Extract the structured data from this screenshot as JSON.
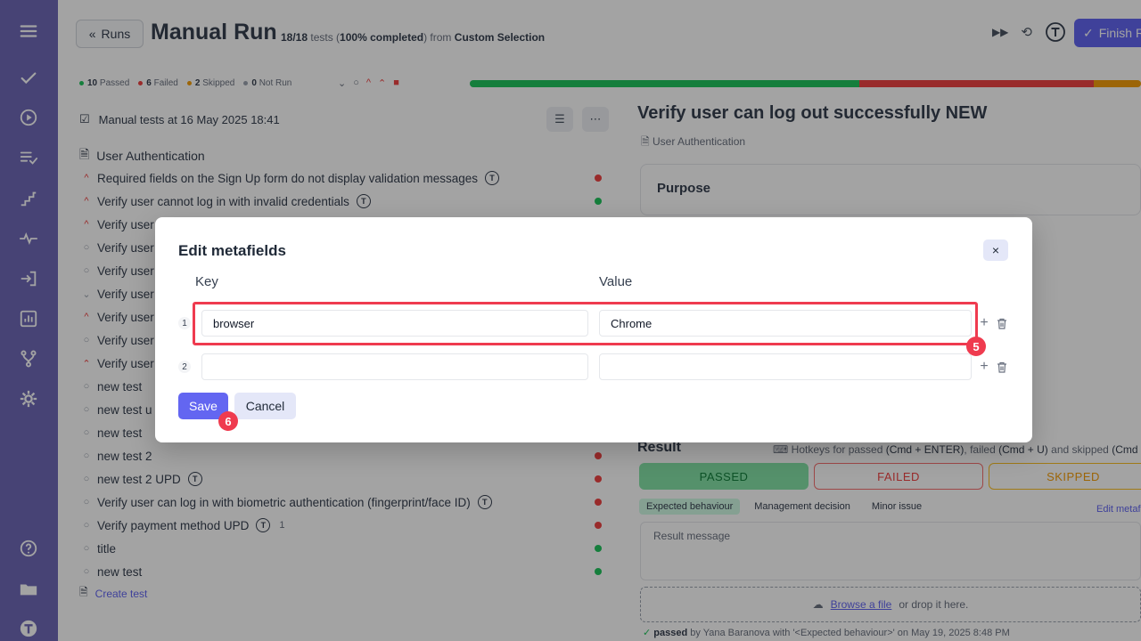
{
  "header": {
    "runs_label": "Runs",
    "title": "Manual Run",
    "count": "18/18",
    "tests_word": "tests (",
    "percent": "100% completed",
    "from_text": ") from",
    "selection": "Custom Selection",
    "finish_label": "Finish R"
  },
  "stats": {
    "passed": "10",
    "passed_label": "Passed",
    "failed": "6",
    "failed_label": "Failed",
    "skipped": "2",
    "skipped_label": "Skipped",
    "notrun": "0",
    "notrun_label": "Not Run"
  },
  "progress": {
    "passed_fraction": 0.58,
    "failed_fraction": 0.35,
    "skipped_fraction": 0.07
  },
  "tree": {
    "header": "Manual tests at 16 May 2025 18:41",
    "suite": "User Authentication",
    "tests": [
      {
        "title": "Required fields on the Sign Up form do not display validation messages",
        "priority": "^",
        "status": "failed"
      },
      {
        "title": "Verify user cannot log in with invalid credentials",
        "priority": "^",
        "status": "passed"
      },
      {
        "title": "Verify user",
        "priority": "^",
        "status": ""
      },
      {
        "title": "Verify user",
        "priority": "○",
        "status": ""
      },
      {
        "title": "Verify user",
        "priority": "○",
        "status": ""
      },
      {
        "title": "Verify user",
        "priority": "⌄",
        "status": ""
      },
      {
        "title": "Verify user",
        "priority": "^",
        "status": ""
      },
      {
        "title": "Verify user",
        "priority": "○",
        "status": ""
      },
      {
        "title": "Verify user",
        "priority": "⌃",
        "status": ""
      },
      {
        "title": "new test",
        "priority": "○",
        "status": ""
      },
      {
        "title": "new test u",
        "priority": "○",
        "status": ""
      },
      {
        "title": "new test",
        "priority": "○",
        "status": ""
      },
      {
        "title": "new test 2",
        "priority": "○",
        "status": "failed"
      },
      {
        "title": "new test 2 UPD",
        "priority": "○",
        "status": "failed"
      },
      {
        "title": "Verify user can log in with biometric authentication (fingerprint/face ID)",
        "priority": "○",
        "status": "failed"
      },
      {
        "title": "Verify payment method UPD",
        "priority": "○",
        "status": "failed",
        "extra": "1"
      },
      {
        "title": "title",
        "priority": "○",
        "status": "passed"
      },
      {
        "title": "new test",
        "priority": "○",
        "status": "passed"
      }
    ],
    "create_label": "Create test"
  },
  "detail": {
    "title": "Verify user can log out successfully NEW",
    "suite": "User Authentication",
    "purpose_label": "Purpose",
    "result_label": "Result",
    "hotkeys": {
      "prefix": "Hotkeys for passed",
      "passed_key": "(Cmd + ENTER)",
      "mid1": ", failed",
      "failed_key": "(Cmd + U)",
      "mid2": "and skipped",
      "skipped_key": "(Cmd -"
    },
    "passed_btn": "PASSED",
    "failed_btn": "FAILED",
    "skipped_btn": "SKIPPED",
    "chips": [
      "Expected behaviour",
      "Management decision",
      "Minor issue"
    ],
    "edit_metafields_link": "Edit metafi",
    "result_placeholder": "Result message",
    "browse": "Browse a file",
    "drop": "or drop it here.",
    "passed_by_prefix": "passed",
    "passed_by_by": "by Yana Baranova with",
    "passed_by_reason": "'<Expected behaviour>'",
    "passed_by_date": "on May 19, 2025 8:48 PM"
  },
  "modal": {
    "title": "Edit metafields",
    "key_label": "Key",
    "value_label": "Value",
    "rows": [
      {
        "num": "1",
        "key": "browser",
        "value": "Chrome"
      },
      {
        "num": "2",
        "key": "",
        "value": ""
      }
    ],
    "save_label": "Save",
    "cancel_label": "Cancel",
    "badge_row": "5",
    "badge_save": "6",
    "close_glyph": "×"
  },
  "colors": {
    "accent": "#6366f1",
    "sidebar": "#6f6ab8",
    "passed": "#22c55e",
    "failed": "#ef4444",
    "skipped": "#f59e0b",
    "highlight": "#ef3b4f"
  }
}
